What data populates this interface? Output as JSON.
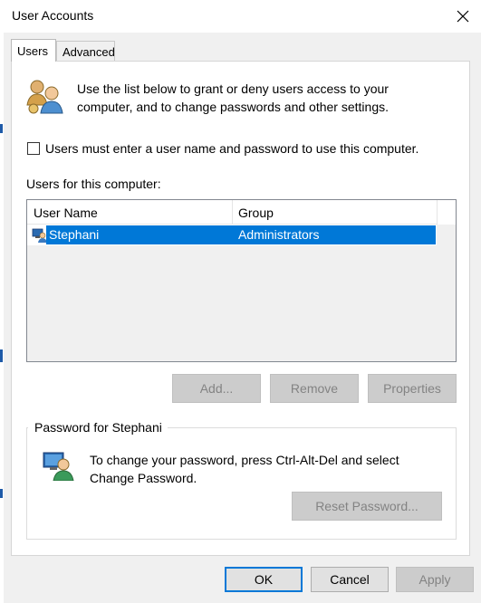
{
  "window": {
    "title": "User Accounts",
    "close_icon": "close-icon"
  },
  "tabs": [
    {
      "label": "Users",
      "active": true
    },
    {
      "label": "Advanced",
      "active": false
    }
  ],
  "users_tab": {
    "info_text": "Use the list below to grant or deny users access to your computer, and to change passwords and other settings.",
    "info_icon": "users-icon",
    "require_login_checkbox": {
      "label": "Users must enter a user name and password to use this computer.",
      "checked": false
    },
    "users_label": "Users for this computer:",
    "columns": [
      "User Name",
      "Group"
    ],
    "rows": [
      {
        "user_name": "Stephani",
        "group": "Administrators",
        "selected": true,
        "icon": "user-admin-icon"
      }
    ],
    "buttons": {
      "add": "Add...",
      "remove": "Remove",
      "properties": "Properties"
    },
    "password_group": {
      "title": "Password for Stephani",
      "text": "To change your password, press Ctrl-Alt-Del and select Change Password.",
      "icon": "user-key-icon",
      "reset_button": "Reset Password..."
    }
  },
  "footer": {
    "ok": "OK",
    "cancel": "Cancel",
    "apply": "Apply"
  },
  "colors": {
    "selection": "#0078d7",
    "panel_bg": "#ffffff",
    "dialog_bg": "#f0f0f0",
    "disabled_text": "#838383"
  }
}
